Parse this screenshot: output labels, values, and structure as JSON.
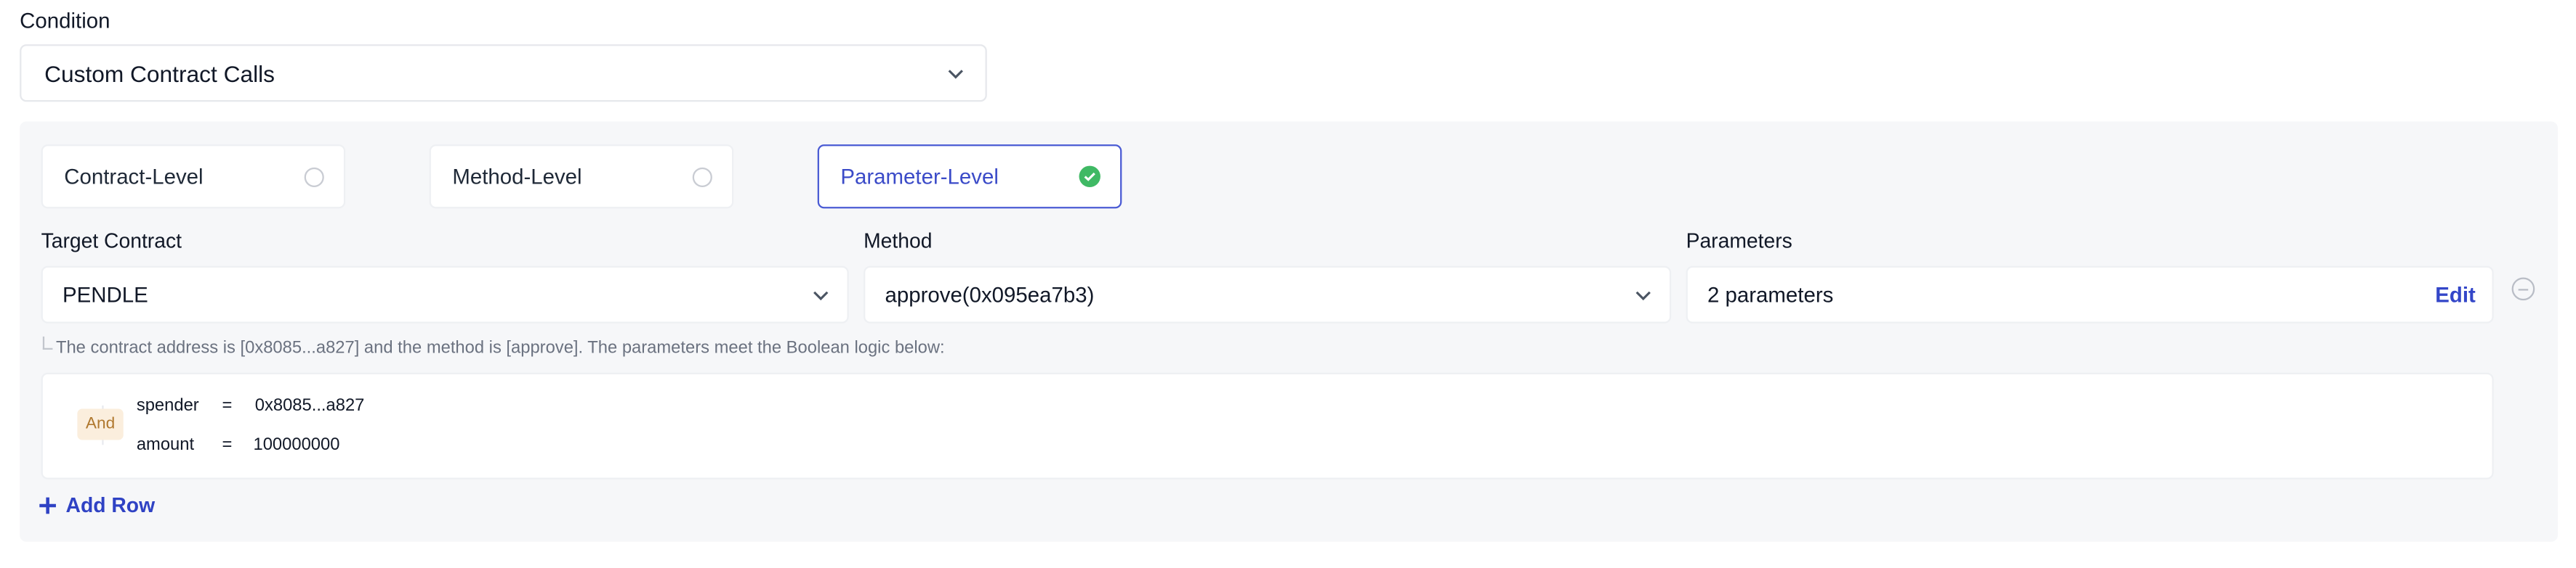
{
  "condition": {
    "label": "Condition",
    "selected": "Custom Contract Calls"
  },
  "levels": [
    {
      "label": "Contract-Level",
      "selected": false
    },
    {
      "label": "Method-Level",
      "selected": false
    },
    {
      "label": "Parameter-Level",
      "selected": true
    }
  ],
  "target_contract": {
    "label": "Target Contract",
    "value": "PENDLE"
  },
  "method": {
    "label": "Method",
    "value": "approve(0x095ea7b3)"
  },
  "parameters": {
    "label": "Parameters",
    "value": "2 parameters",
    "edit_label": "Edit"
  },
  "hint": "The contract address is [0x8085...a827] and the method is [approve]. The parameters meet the Boolean logic below:",
  "logic": {
    "operator": "And",
    "rows": [
      {
        "name": "spender",
        "op": "=",
        "value": "0x8085...a827"
      },
      {
        "name": "amount",
        "op": "=",
        "value": "100000000"
      }
    ]
  },
  "add_row_label": "Add Row",
  "colors": {
    "accent": "#3346c8",
    "success": "#3fb964",
    "badge_bg": "#fbeedd",
    "badge_text": "#b0782e",
    "panel_bg": "#f6f7f9"
  },
  "icons": [
    "chevron-down-icon",
    "check-circle-icon",
    "radio-empty-icon",
    "minus-circle-icon",
    "plus-icon"
  ]
}
